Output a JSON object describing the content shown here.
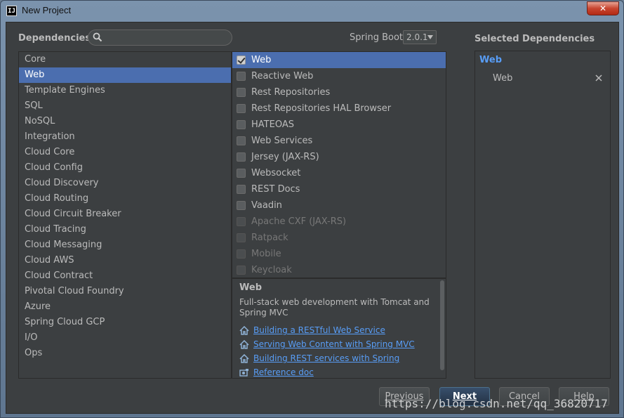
{
  "window": {
    "title": "New Project",
    "app_icon": "IJ",
    "close_label": "✕"
  },
  "header": {
    "dependencies_label": "Dependencies",
    "search": {
      "value": "",
      "placeholder": ""
    },
    "spring_boot_label": "Spring Boot",
    "spring_boot_version": "2.0.1",
    "selected_title": "Selected Dependencies"
  },
  "categories": [
    {
      "label": "Core",
      "active": false
    },
    {
      "label": "Web",
      "active": true
    },
    {
      "label": "Template Engines",
      "active": false
    },
    {
      "label": "SQL",
      "active": false
    },
    {
      "label": "NoSQL",
      "active": false
    },
    {
      "label": "Integration",
      "active": false
    },
    {
      "label": "Cloud Core",
      "active": false
    },
    {
      "label": "Cloud Config",
      "active": false
    },
    {
      "label": "Cloud Discovery",
      "active": false
    },
    {
      "label": "Cloud Routing",
      "active": false
    },
    {
      "label": "Cloud Circuit Breaker",
      "active": false
    },
    {
      "label": "Cloud Tracing",
      "active": false
    },
    {
      "label": "Cloud Messaging",
      "active": false
    },
    {
      "label": "Cloud AWS",
      "active": false
    },
    {
      "label": "Cloud Contract",
      "active": false
    },
    {
      "label": "Pivotal Cloud Foundry",
      "active": false
    },
    {
      "label": "Azure",
      "active": false
    },
    {
      "label": "Spring Cloud GCP",
      "active": false
    },
    {
      "label": "I/O",
      "active": false
    },
    {
      "label": "Ops",
      "active": false
    }
  ],
  "dependencies": [
    {
      "label": "Web",
      "checked": true,
      "active": true,
      "disabled": false
    },
    {
      "label": "Reactive Web",
      "checked": false,
      "active": false,
      "disabled": false
    },
    {
      "label": "Rest Repositories",
      "checked": false,
      "active": false,
      "disabled": false
    },
    {
      "label": "Rest Repositories HAL Browser",
      "checked": false,
      "active": false,
      "disabled": false
    },
    {
      "label": "HATEOAS",
      "checked": false,
      "active": false,
      "disabled": false
    },
    {
      "label": "Web Services",
      "checked": false,
      "active": false,
      "disabled": false
    },
    {
      "label": "Jersey (JAX-RS)",
      "checked": false,
      "active": false,
      "disabled": false
    },
    {
      "label": "Websocket",
      "checked": false,
      "active": false,
      "disabled": false
    },
    {
      "label": "REST Docs",
      "checked": false,
      "active": false,
      "disabled": false
    },
    {
      "label": "Vaadin",
      "checked": false,
      "active": false,
      "disabled": false
    },
    {
      "label": "Apache CXF (JAX-RS)",
      "checked": false,
      "active": false,
      "disabled": true
    },
    {
      "label": "Ratpack",
      "checked": false,
      "active": false,
      "disabled": true
    },
    {
      "label": "Mobile",
      "checked": false,
      "active": false,
      "disabled": true
    },
    {
      "label": "Keycloak",
      "checked": false,
      "active": false,
      "disabled": true
    }
  ],
  "description": {
    "title": "Web",
    "text": "Full-stack web development with Tomcat and Spring MVC",
    "links": [
      {
        "label": "Building a RESTful Web Service",
        "icon": "home-icon"
      },
      {
        "label": "Serving Web Content with Spring MVC",
        "icon": "home-icon"
      },
      {
        "label": "Building REST services with Spring",
        "icon": "home-icon"
      },
      {
        "label": "Reference doc",
        "icon": "book-icon"
      }
    ]
  },
  "selected": {
    "group": "Web",
    "items": [
      "Web"
    ]
  },
  "buttons": {
    "previous": "Previous",
    "next": "Next",
    "cancel": "Cancel",
    "help": "Help"
  },
  "watermark": "https://blog.csdn.net/qq_36820717",
  "colors": {
    "accent": "#4b6eaf",
    "link": "#589df6",
    "background": "#3c3f41"
  }
}
